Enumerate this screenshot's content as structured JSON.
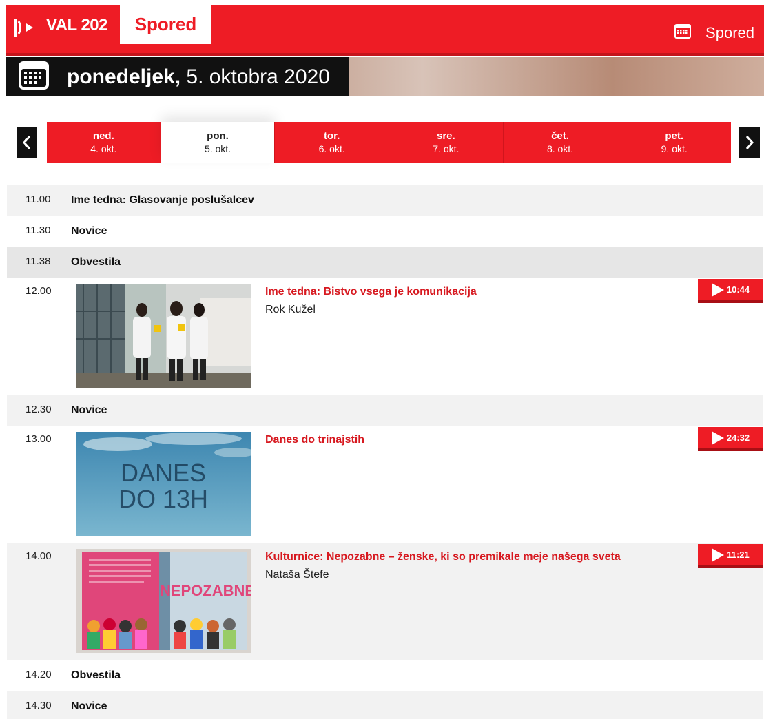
{
  "header": {
    "brand": "VAL 202",
    "section": "Spored",
    "right_label": "Spored",
    "colors": {
      "accent": "#ee1c25",
      "dark": "#111111"
    }
  },
  "banner": {
    "weekday": "ponedeljek,",
    "date": "5. oktobra 2020"
  },
  "days": [
    {
      "name": "ned.",
      "date": "4. okt.",
      "active": false
    },
    {
      "name": "pon.",
      "date": "5. okt.",
      "active": true
    },
    {
      "name": "tor.",
      "date": "6. okt.",
      "active": false
    },
    {
      "name": "sre.",
      "date": "7. okt.",
      "active": false
    },
    {
      "name": "čet.",
      "date": "8. okt.",
      "active": false
    },
    {
      "name": "pet.",
      "date": "9. okt.",
      "active": false
    }
  ],
  "schedule": [
    {
      "time": "11.00",
      "title": "Ime tedna: Glasovanje poslušalcev"
    },
    {
      "time": "11.30",
      "title": "Novice"
    },
    {
      "time": "11.38",
      "title": "Obvestila"
    },
    {
      "time": "12.00",
      "title": "Ime tedna: Bistvo vsega je komunikacija",
      "author": "Rok Kužel",
      "duration": "10:44"
    },
    {
      "time": "12.30",
      "title": "Novice"
    },
    {
      "time": "13.00",
      "title": "Danes do trinajstih",
      "duration": "24:32",
      "thumb_text": [
        "DANES",
        "DO 13H"
      ]
    },
    {
      "time": "14.00",
      "title": "Kulturnice: Nepozabne – ženske, ki so premikale meje našega sveta",
      "author": "Nataša Štefe",
      "duration": "11:21",
      "thumb_text": [
        "NEPOZABNE"
      ]
    },
    {
      "time": "14.20",
      "title": "Obvestila"
    },
    {
      "time": "14.30",
      "title": "Novice"
    }
  ]
}
